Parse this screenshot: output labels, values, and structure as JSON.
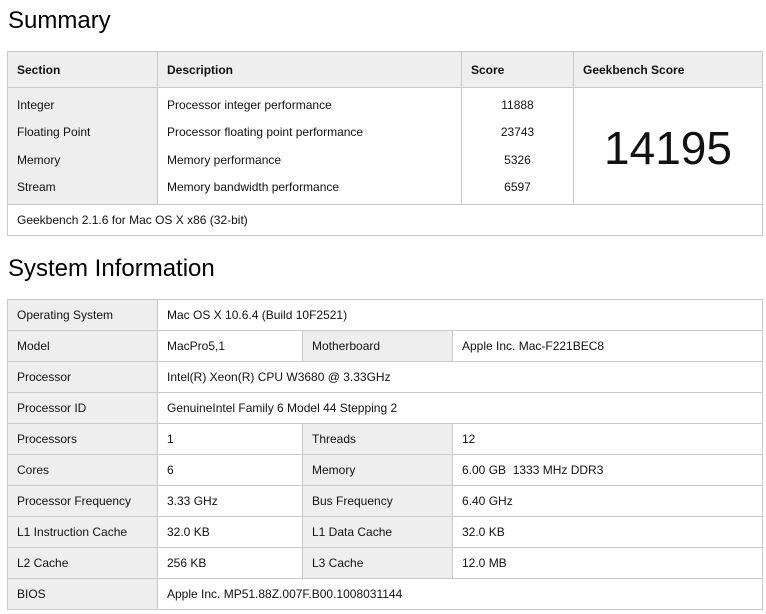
{
  "summary": {
    "heading": "Summary",
    "columns": {
      "section": "Section",
      "description": "Description",
      "score": "Score",
      "geekbench_score": "Geekbench Score"
    },
    "rows": [
      {
        "section": "Integer",
        "description": "Processor integer performance",
        "score": "11888"
      },
      {
        "section": "Floating Point",
        "description": "Processor floating point performance",
        "score": "23743"
      },
      {
        "section": "Memory",
        "description": "Memory performance",
        "score": "5326"
      },
      {
        "section": "Stream",
        "description": "Memory bandwidth performance",
        "score": "6597"
      }
    ],
    "geekbench_score": "14195",
    "footer": "Geekbench 2.1.6 for Mac OS X x86 (32-bit)"
  },
  "system": {
    "heading": "System Information",
    "operating_system": {
      "label": "Operating System",
      "value": "Mac OS X 10.6.4 (Build 10F2521)"
    },
    "model": {
      "label": "Model",
      "value": "MacPro5,1"
    },
    "motherboard": {
      "label": "Motherboard",
      "value": "Apple Inc. Mac-F221BEC8"
    },
    "processor": {
      "label": "Processor",
      "value": "Intel(R) Xeon(R) CPU W3680 @ 3.33GHz"
    },
    "processor_id": {
      "label": "Processor ID",
      "value": "GenuineIntel Family 6 Model 44 Stepping 2"
    },
    "processors": {
      "label": "Processors",
      "value": "1"
    },
    "threads": {
      "label": "Threads",
      "value": "12"
    },
    "cores": {
      "label": "Cores",
      "value": "6"
    },
    "memory": {
      "label": "Memory",
      "value": "6.00 GB  1333 MHz DDR3"
    },
    "processor_frequency": {
      "label": "Processor Frequency",
      "value": "3.33 GHz"
    },
    "bus_frequency": {
      "label": "Bus Frequency",
      "value": "6.40 GHz"
    },
    "l1_instruction_cache": {
      "label": "L1 Instruction Cache",
      "value": "32.0 KB"
    },
    "l1_data_cache": {
      "label": "L1 Data Cache",
      "value": "32.0 KB"
    },
    "l2_cache": {
      "label": "L2 Cache",
      "value": "256 KB"
    },
    "l3_cache": {
      "label": "L3 Cache",
      "value": "12.0 MB"
    },
    "bios": {
      "label": "BIOS",
      "value": "Apple Inc. MP51.88Z.007F.B00.1008031144"
    }
  }
}
